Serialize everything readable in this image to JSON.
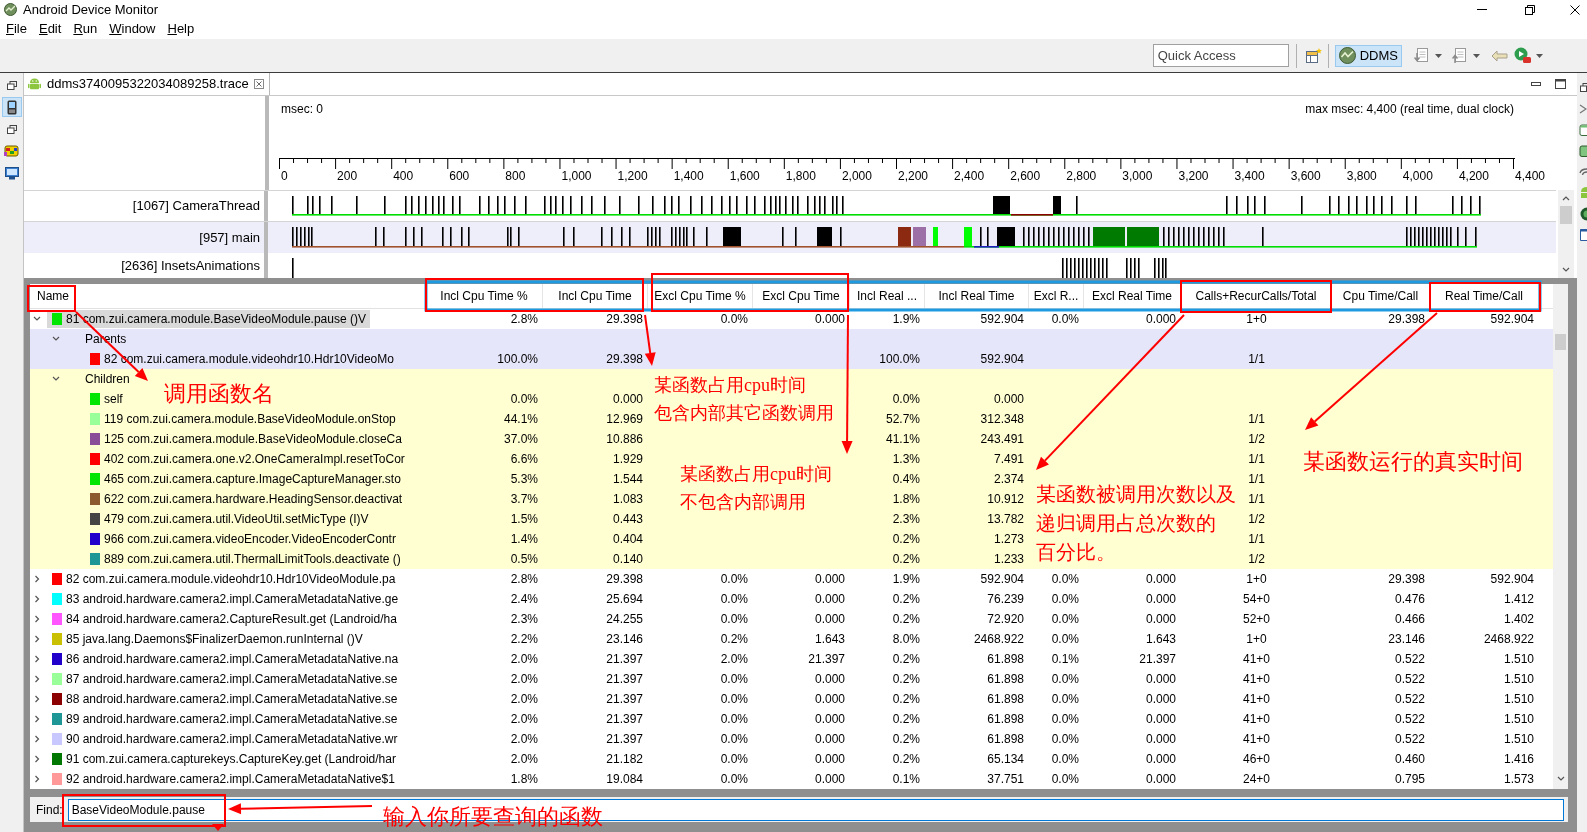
{
  "window": {
    "title": "Android Device Monitor"
  },
  "menu": [
    {
      "label": "File"
    },
    {
      "label": "Edit"
    },
    {
      "label": "Run"
    },
    {
      "label": "Window"
    },
    {
      "label": "Help"
    }
  ],
  "toolbar": {
    "quick_access": {
      "placeholder": "Quick Access"
    },
    "perspective": {
      "label": "DDMS",
      "selected": true
    }
  },
  "left_trim": [
    {
      "selected": false
    },
    {
      "selected": true
    },
    {
      "selected": false
    },
    {
      "selected": false
    },
    {
      "selected": false
    }
  ],
  "editor_tab": {
    "title": "ddms3740095322034089258.trace"
  },
  "timeline": {
    "start_label": "msec: 0",
    "end_label": "max msec: 4,400 (real time, dual clock)",
    "ticks": [
      "0",
      "200",
      "400",
      "600",
      "800",
      "1,000",
      "1,200",
      "1,400",
      "1,600",
      "1,800",
      "2,000",
      "2,200",
      "2,400",
      "2,600",
      "2,800",
      "3,000",
      "3,200",
      "3,400",
      "3,600",
      "3,800",
      "4,000",
      "4,200",
      "4,400"
    ],
    "threads": [
      {
        "name": "[1067] CameraThread",
        "selected": false
      },
      {
        "name": "[957] main",
        "selected": true
      },
      {
        "name": "[2636] InsetsAnimations",
        "selected": false
      }
    ]
  },
  "table": {
    "columns": [
      "Name",
      "Incl Cpu Time %",
      "Incl Cpu Time",
      "Excl Cpu Time %",
      "Excl Cpu Time",
      "Incl Real ...",
      "Incl Real Time",
      "Excl R...",
      "Excl Real Time",
      "Calls+RecurCalls/Total",
      "Cpu Time/Call",
      "Real Time/Call"
    ],
    "rows": [
      {
        "kind": "method",
        "name": "81 com.zui.camera.module.BaseVideoModule.pause ()V",
        "color": "#00e600",
        "selected": true,
        "expanded": true,
        "cells": {
          "incl_cpu_time_pct": "2.8%",
          "incl_cpu_time": "29.398",
          "excl_cpu_time_pct": "0.0%",
          "excl_cpu_time": "0.000",
          "column_6": "1.9%",
          "incl_real_time": "592.904",
          "column_8": "0.0%",
          "excl_real_time": "0.000",
          "calls_recur_calls_total": "1+0",
          "cpu_time_per_call": "29.398",
          "real_time_per_call": "592.904"
        },
        "children": [
          {
            "kind": "parents",
            "name": "Parents",
            "selected": false,
            "expanded": true,
            "children": [
              {
                "kind": "method",
                "name": "82 com.zui.camera.module.videohdr10.Hdr10VideoMo",
                "color": "#ff0000",
                "selected": false,
                "cells": {
                  "incl_cpu_time_pct": "100.0%",
                  "incl_cpu_time": "29.398",
                  "column_6": "100.0%",
                  "incl_real_time": "592.904",
                  "calls_recur_calls_total": "1/1"
                }
              }
            ]
          },
          {
            "kind": "children",
            "name": "Children",
            "selected": false,
            "expanded": true,
            "children": [
              {
                "kind": "method",
                "name": "self",
                "color": "#00e600",
                "selected": false,
                "cells": {
                  "incl_cpu_time_pct": "0.0%",
                  "incl_cpu_time": "0.000",
                  "column_6": "0.0%",
                  "incl_real_time": "0.000"
                }
              },
              {
                "kind": "method",
                "name": "119 com.zui.camera.module.BaseVideoModule.onStop",
                "color": "#99ff99",
                "selected": false,
                "cells": {
                  "incl_cpu_time_pct": "44.1%",
                  "incl_cpu_time": "12.969",
                  "column_6": "52.7%",
                  "incl_real_time": "312.348",
                  "calls_recur_calls_total": "1/1"
                }
              },
              {
                "kind": "method",
                "name": "125 com.zui.camera.module.BaseVideoModule.closeCa",
                "color": "#8a4e98",
                "selected": false,
                "cells": {
                  "incl_cpu_time_pct": "37.0%",
                  "incl_cpu_time": "10.886",
                  "column_6": "41.1%",
                  "incl_real_time": "243.491",
                  "calls_recur_calls_total": "1/2"
                }
              },
              {
                "kind": "method",
                "name": "402 com.zui.camera.one.v2.OneCameraImpl.resetToCor",
                "color": "#ff0000",
                "selected": false,
                "cells": {
                  "incl_cpu_time_pct": "6.6%",
                  "incl_cpu_time": "1.929",
                  "column_6": "1.3%",
                  "incl_real_time": "7.491",
                  "calls_recur_calls_total": "1/1"
                }
              },
              {
                "kind": "method",
                "name": "465 com.zui.camera.capture.ImageCaptureManager.sto",
                "color": "#00e600",
                "selected": false,
                "cells": {
                  "incl_cpu_time_pct": "5.3%",
                  "incl_cpu_time": "1.544",
                  "column_6": "0.4%",
                  "incl_real_time": "2.374",
                  "calls_recur_calls_total": "1/1"
                }
              },
              {
                "kind": "method",
                "name": "622 com.zui.camera.hardware.HeadingSensor.deactivat",
                "color": "#8b5a2e",
                "selected": false,
                "cells": {
                  "incl_cpu_time_pct": "3.7%",
                  "incl_cpu_time": "1.083",
                  "column_6": "1.8%",
                  "incl_real_time": "10.912",
                  "calls_recur_calls_total": "1/1"
                }
              },
              {
                "kind": "method",
                "name": "479 com.zui.camera.util.VideoUtil.setMicType (I)V",
                "color": "#444444",
                "selected": false,
                "cells": {
                  "incl_cpu_time_pct": "1.5%",
                  "incl_cpu_time": "0.443",
                  "column_6": "2.3%",
                  "incl_real_time": "13.782",
                  "calls_recur_calls_total": "1/2"
                }
              },
              {
                "kind": "method",
                "name": "966 com.zui.camera.videoEncoder.VideoEncoderContr",
                "color": "#2200cc",
                "selected": false,
                "cells": {
                  "incl_cpu_time_pct": "1.4%",
                  "incl_cpu_time": "0.404",
                  "column_6": "0.2%",
                  "incl_real_time": "1.273",
                  "calls_recur_calls_total": "1/1"
                }
              },
              {
                "kind": "method",
                "name": "889 com.zui.camera.util.ThermalLimitTools.deactivate ()",
                "color": "#1e9696",
                "selected": false,
                "cells": {
                  "incl_cpu_time_pct": "0.5%",
                  "incl_cpu_time": "0.140",
                  "column_6": "0.2%",
                  "incl_real_time": "1.233",
                  "calls_recur_calls_total": "1/2"
                }
              }
            ]
          }
        ]
      },
      {
        "kind": "method",
        "name": "82 com.zui.camera.module.videohdr10.Hdr10VideoModule.pa",
        "color": "#ff0000",
        "selected": false,
        "expanded": false,
        "cells": {
          "incl_cpu_time_pct": "2.8%",
          "incl_cpu_time": "29.398",
          "excl_cpu_time_pct": "0.0%",
          "excl_cpu_time": "0.000",
          "column_6": "1.9%",
          "incl_real_time": "592.904",
          "column_8": "0.0%",
          "excl_real_time": "0.000",
          "calls_recur_calls_total": "1+0",
          "cpu_time_per_call": "29.398",
          "real_time_per_call": "592.904"
        }
      },
      {
        "kind": "method",
        "name": "83 android.hardware.camera2.impl.CameraMetadataNative.ge",
        "color": "#00ffff",
        "selected": false,
        "expanded": false,
        "cells": {
          "incl_cpu_time_pct": "2.4%",
          "incl_cpu_time": "25.694",
          "excl_cpu_time_pct": "0.0%",
          "excl_cpu_time": "0.000",
          "column_6": "0.2%",
          "incl_real_time": "76.239",
          "column_8": "0.0%",
          "excl_real_time": "0.000",
          "calls_recur_calls_total": "54+0",
          "cpu_time_per_call": "0.476",
          "real_time_per_call": "1.412"
        }
      },
      {
        "kind": "method",
        "name": "84 android.hardware.camera2.CaptureResult.get (Landroid/ha",
        "color": "#ff55ff",
        "selected": false,
        "expanded": false,
        "cells": {
          "incl_cpu_time_pct": "2.3%",
          "incl_cpu_time": "24.255",
          "excl_cpu_time_pct": "0.0%",
          "excl_cpu_time": "0.000",
          "column_6": "0.2%",
          "incl_real_time": "72.920",
          "column_8": "0.0%",
          "excl_real_time": "0.000",
          "calls_recur_calls_total": "52+0",
          "cpu_time_per_call": "0.466",
          "real_time_per_call": "1.402"
        }
      },
      {
        "kind": "method",
        "name": "85 java.lang.Daemons$FinalizerDaemon.runInternal ()V",
        "color": "#c8c000",
        "selected": false,
        "expanded": false,
        "cells": {
          "incl_cpu_time_pct": "2.2%",
          "incl_cpu_time": "23.146",
          "excl_cpu_time_pct": "0.2%",
          "excl_cpu_time": "1.643",
          "column_6": "8.0%",
          "incl_real_time": "2468.922",
          "column_8": "0.0%",
          "excl_real_time": "1.643",
          "calls_recur_calls_total": "1+0",
          "cpu_time_per_call": "23.146",
          "real_time_per_call": "2468.922"
        }
      },
      {
        "kind": "method",
        "name": "86 android.hardware.camera2.impl.CameraMetadataNative.na",
        "color": "#2200cc",
        "selected": false,
        "expanded": false,
        "cells": {
          "incl_cpu_time_pct": "2.0%",
          "incl_cpu_time": "21.397",
          "excl_cpu_time_pct": "2.0%",
          "excl_cpu_time": "21.397",
          "column_6": "0.2%",
          "incl_real_time": "61.898",
          "column_8": "0.1%",
          "excl_real_time": "21.397",
          "calls_recur_calls_total": "41+0",
          "cpu_time_per_call": "0.522",
          "real_time_per_call": "1.510"
        }
      },
      {
        "kind": "method",
        "name": "87 android.hardware.camera2.impl.CameraMetadataNative.se",
        "color": "#99ff99",
        "selected": false,
        "expanded": false,
        "cells": {
          "incl_cpu_time_pct": "2.0%",
          "incl_cpu_time": "21.397",
          "excl_cpu_time_pct": "0.0%",
          "excl_cpu_time": "0.000",
          "column_6": "0.2%",
          "incl_real_time": "61.898",
          "column_8": "0.0%",
          "excl_real_time": "0.000",
          "calls_recur_calls_total": "41+0",
          "cpu_time_per_call": "0.522",
          "real_time_per_call": "1.510"
        }
      },
      {
        "kind": "method",
        "name": "88 android.hardware.camera2.impl.CameraMetadataNative.se",
        "color": "#8b0000",
        "selected": false,
        "expanded": false,
        "cells": {
          "incl_cpu_time_pct": "2.0%",
          "incl_cpu_time": "21.397",
          "excl_cpu_time_pct": "0.0%",
          "excl_cpu_time": "0.000",
          "column_6": "0.2%",
          "incl_real_time": "61.898",
          "column_8": "0.0%",
          "excl_real_time": "0.000",
          "calls_recur_calls_total": "41+0",
          "cpu_time_per_call": "0.522",
          "real_time_per_call": "1.510"
        }
      },
      {
        "kind": "method",
        "name": "89 android.hardware.camera2.impl.CameraMetadataNative.se",
        "color": "#1e9696",
        "selected": false,
        "expanded": false,
        "cells": {
          "incl_cpu_time_pct": "2.0%",
          "incl_cpu_time": "21.397",
          "excl_cpu_time_pct": "0.0%",
          "excl_cpu_time": "0.000",
          "column_6": "0.2%",
          "incl_real_time": "61.898",
          "column_8": "0.0%",
          "excl_real_time": "0.000",
          "calls_recur_calls_total": "41+0",
          "cpu_time_per_call": "0.522",
          "real_time_per_call": "1.510"
        }
      },
      {
        "kind": "method",
        "name": "90 android.hardware.camera2.impl.CameraMetadataNative.wr",
        "color": "#c8c8ff",
        "selected": false,
        "expanded": false,
        "cells": {
          "incl_cpu_time_pct": "2.0%",
          "incl_cpu_time": "21.397",
          "excl_cpu_time_pct": "0.0%",
          "excl_cpu_time": "0.000",
          "column_6": "0.2%",
          "incl_real_time": "61.898",
          "column_8": "0.0%",
          "excl_real_time": "0.000",
          "calls_recur_calls_total": "41+0",
          "cpu_time_per_call": "0.522",
          "real_time_per_call": "1.510"
        }
      },
      {
        "kind": "method",
        "name": "91 com.zui.camera.capturekeys.CaptureKey.get (Landroid/har",
        "color": "#007700",
        "selected": false,
        "expanded": false,
        "cells": {
          "incl_cpu_time_pct": "2.0%",
          "incl_cpu_time": "21.182",
          "excl_cpu_time_pct": "0.0%",
          "excl_cpu_time": "0.000",
          "column_6": "0.2%",
          "incl_real_time": "65.134",
          "column_8": "0.0%",
          "excl_real_time": "0.000",
          "calls_recur_calls_total": "46+0",
          "cpu_time_per_call": "0.460",
          "real_time_per_call": "1.416"
        }
      },
      {
        "kind": "method",
        "name": "92 android.hardware.camera2.impl.CameraMetadataNative$1",
        "color": "#ff9999",
        "selected": false,
        "expanded": false,
        "cells": {
          "incl_cpu_time_pct": "1.8%",
          "incl_cpu_time": "19.084",
          "excl_cpu_time_pct": "0.0%",
          "excl_cpu_time": "0.000",
          "column_6": "0.1%",
          "incl_real_time": "37.751",
          "column_8": "0.0%",
          "excl_real_time": "0.000",
          "calls_recur_calls_total": "24+0",
          "cpu_time_per_call": "0.795",
          "real_time_per_call": "1.573"
        }
      }
    ]
  },
  "find": {
    "label": "Find:",
    "value": "BaseVideoModule.pause"
  },
  "annotations": [
    {
      "lines": [
        "调用函数名"
      ]
    },
    {
      "lines": [
        "某函数占用cpu时间",
        "包含内部其它函数调用"
      ]
    },
    {
      "lines": [
        "某函数占用cpu时间",
        "不包含内部调用"
      ]
    },
    {
      "lines": [
        "某函数被调用次数以及",
        "递归调用占总次数的",
        "百分比。"
      ]
    },
    {
      "lines": [
        "某函数运行的真实时间"
      ]
    },
    {
      "lines": [
        "输入你所要查询的函数"
      ]
    }
  ]
}
